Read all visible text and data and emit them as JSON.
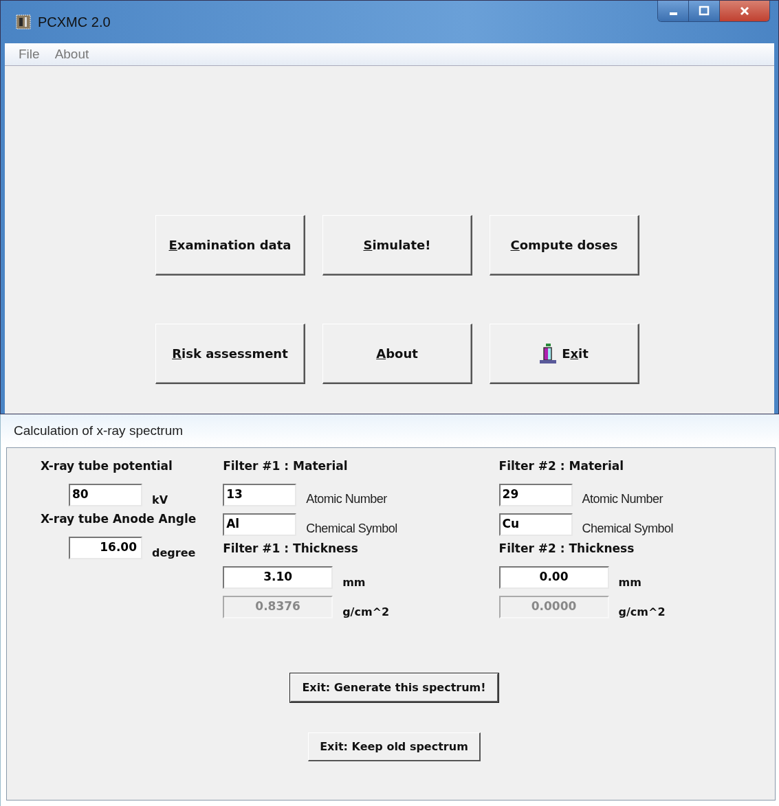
{
  "window": {
    "title": "PCXMC 2.0"
  },
  "menu": [
    "File",
    "About"
  ],
  "buttons": [
    {
      "key": "E",
      "post": "xamination data",
      "kind": "text"
    },
    {
      "key": "S",
      "post": "imulate!",
      "kind": "text"
    },
    {
      "key": "C",
      "post": "ompute doses",
      "kind": "text"
    },
    {
      "key": "R",
      "post": "isk assessment",
      "kind": "text"
    },
    {
      "key": "A",
      "post": "bout",
      "kind": "text"
    },
    {
      "pre": "E",
      "key": "x",
      "post": "it",
      "kind": "icon"
    }
  ],
  "dialog": {
    "title": "Calculation of x-ray spectrum",
    "tube": {
      "potential_label": "X-ray tube potential",
      "potential": {
        "value": "80",
        "unit": "kV"
      },
      "angle_label": "X-ray tube Anode Angle",
      "angle": {
        "value": "16.00",
        "unit": "degree"
      }
    },
    "filters": [
      {
        "material_label": "Filter #1 : Material",
        "atomic_number": "13",
        "atomic_number_label": "Atomic Number",
        "symbol": "Al",
        "symbol_label": "Chemical Symbol",
        "thickness_label": "Filter #1 : Thickness",
        "thickness": {
          "value": "3.10",
          "disabled": false
        },
        "thickness_unit": "mm",
        "density": {
          "value": "0.8376",
          "disabled": true
        },
        "density_unit": "g/cm^2"
      },
      {
        "material_label": "Filter #2 : Material",
        "atomic_number": "29",
        "atomic_number_label": "Atomic Number",
        "symbol": "Cu",
        "symbol_label": "Chemical Symbol",
        "thickness_label": "Filter #2 : Thickness",
        "thickness": {
          "value": "0.00",
          "disabled": false
        },
        "thickness_unit": "mm",
        "density": {
          "value": "0.0000",
          "disabled": true
        },
        "density_unit": "g/cm^2"
      }
    ],
    "actions": [
      {
        "label": "Exit: Generate this spectrum!",
        "default": true
      },
      {
        "label": "Exit: Keep old spectrum",
        "default": false
      }
    ]
  }
}
